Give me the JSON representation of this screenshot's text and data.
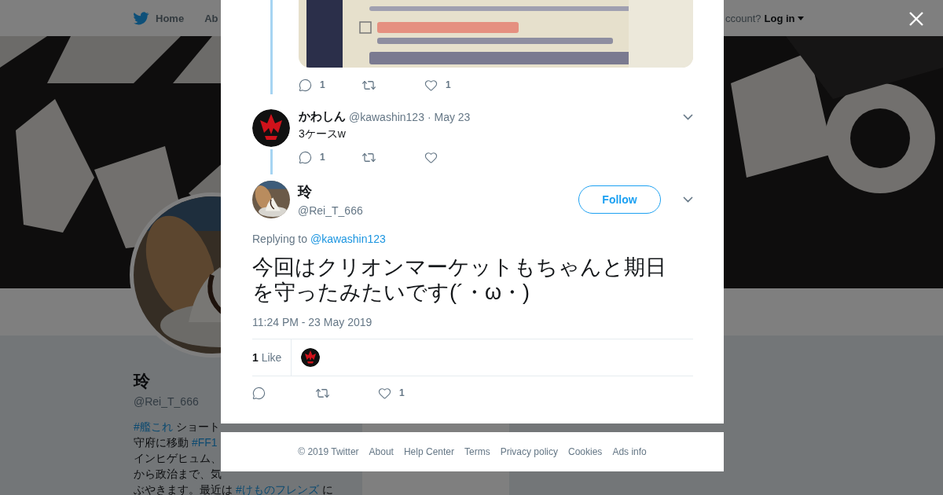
{
  "nav": {
    "items": [
      {
        "label": "Home"
      },
      {
        "label": "Ab"
      }
    ],
    "account_prompt": "ccount?",
    "login": "Log in"
  },
  "profile": {
    "name": "玲",
    "handle": "@Rei_T_666",
    "bio_lines": [
      [
        {
          "kind": "hashtag",
          "text": "#艦これ"
        },
        {
          "kind": "plain",
          "text": " ショート"
        }
      ],
      [
        {
          "kind": "plain",
          "text": "守府に移動 "
        },
        {
          "kind": "hashtag",
          "text": "#FF1"
        }
      ],
      [
        {
          "kind": "plain",
          "text": "インヒゲヒュム、"
        }
      ],
      [
        {
          "kind": "plain",
          "text": "から政治まで、気"
        }
      ],
      [
        {
          "kind": "plain",
          "text": "ぶやきます。最近は "
        },
        {
          "kind": "hashtag",
          "text": "#けものフレンズ"
        },
        {
          "kind": "plain",
          "text": " に"
        }
      ]
    ]
  },
  "modal": {
    "photo_tweet": {
      "actions": [
        {
          "kind": "reply",
          "count": "1"
        },
        {
          "kind": "retweet"
        },
        {
          "kind": "like",
          "count": "1"
        }
      ]
    },
    "reply": {
      "name": "かわしん",
      "handle": "@kawashin123",
      "date": "· May 23",
      "text": "3ケースw",
      "actions": [
        {
          "kind": "reply",
          "count": "1"
        },
        {
          "kind": "retweet"
        },
        {
          "kind": "like"
        }
      ]
    },
    "tweet": {
      "name": "玲",
      "handle": "@Rei_T_666",
      "follow": "Follow",
      "replying_label": "Replying to",
      "replying_to": "@kawashin123",
      "text": "今回はクリオンマーケットもちゃんと期日を守ったみたいです(´・ω・)",
      "timestamp": "11:24 PM - 23 May 2019",
      "likes_count": "1",
      "likes_label": "Like",
      "actions": [
        {
          "kind": "reply"
        },
        {
          "kind": "retweet"
        },
        {
          "kind": "like",
          "count": "1"
        }
      ]
    }
  },
  "footer": {
    "links": [
      "© 2019 Twitter",
      "About",
      "Help Center",
      "Terms",
      "Privacy policy",
      "Cookies",
      "Ads info"
    ]
  }
}
